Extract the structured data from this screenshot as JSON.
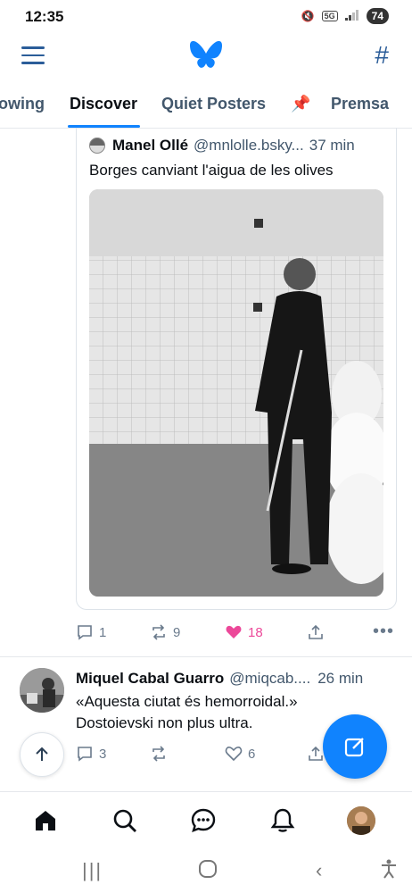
{
  "status_bar": {
    "time": "12:35",
    "network": "5G",
    "battery": "74",
    "icons": [
      "mute-icon",
      "signal-icon",
      "battery-icon"
    ]
  },
  "top_bar": {
    "icons": [
      "menu-icon",
      "butterfly-logo",
      "hashtag-icon"
    ],
    "logo_color": "#1083fe"
  },
  "tabs": [
    {
      "label": "owing"
    },
    {
      "label": "Discover",
      "active": true
    },
    {
      "label": "Quiet Posters"
    },
    {
      "label": "📌"
    },
    {
      "label": "Premsa"
    }
  ],
  "quoted_post": {
    "author": "Manel Ollé",
    "handle": "@mnlolle.bsky...",
    "time": "37 min",
    "text": "Borges canviant l'aigua de les olives"
  },
  "post1_actions": {
    "replies": "1",
    "reposts": "9",
    "likes": "18",
    "like_color": "#ec4899"
  },
  "post2": {
    "author": "Miquel Cabal Guarro",
    "handle": "@miqcab....",
    "time": "26 min",
    "line1": "«Aquesta ciutat és hemorroidal.»",
    "line2": "Dostoievski non plus ultra.",
    "replies": "3",
    "reposts": "",
    "likes": "6"
  },
  "bottom_nav": {
    "items": [
      "home-icon",
      "search-icon",
      "chat-icon",
      "bell-icon",
      "profile-avatar"
    ]
  },
  "accent_color": "#1083fe"
}
